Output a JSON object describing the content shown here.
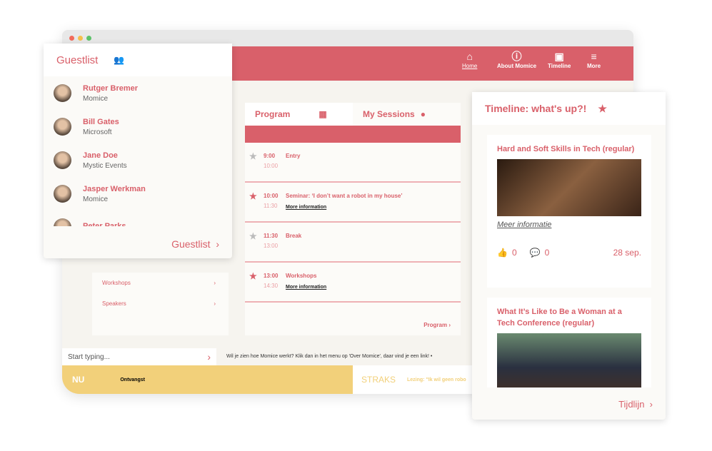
{
  "nav": [
    {
      "label": "Home",
      "icon": "home-icon"
    },
    {
      "label": "About Momice",
      "icon": "info-icon"
    },
    {
      "label": "Timeline",
      "icon": "tv-icon"
    },
    {
      "label": "More",
      "icon": "menu-icon"
    }
  ],
  "program": {
    "tabs": [
      "Program",
      "My Sessions"
    ],
    "link": "Program",
    "sessions": [
      {
        "start": "9:00",
        "end": "10:00",
        "title": "Entry",
        "starred": false,
        "more": ""
      },
      {
        "start": "10:00",
        "end": "11:30",
        "title": "Seminar: ‘I don’t want a robot in my house’",
        "starred": true,
        "more": "More information"
      },
      {
        "start": "11:30",
        "end": "13:00",
        "title": "Break",
        "starred": false,
        "more": ""
      },
      {
        "start": "13:00",
        "end": "14:30",
        "title": "Workshops",
        "starred": true,
        "more": "More information"
      }
    ]
  },
  "side": [
    "Workshops",
    "Speakers"
  ],
  "search": {
    "placeholder": "Start typing..."
  },
  "ticker": "Wil je zien hoe Momice werkt? Klik dan in het menu op 'Over Momice', daar vind je een link!   •",
  "now": {
    "label": "NU",
    "text": "Ontvangst"
  },
  "later": {
    "label": "STRAKS",
    "text": "Lezing: \"Ik wil geen robo"
  },
  "guestlist": {
    "title": "Guestlist",
    "footer": "Guestlist",
    "people": [
      {
        "name": "Rutger Bremer",
        "company": "Momice"
      },
      {
        "name": "Bill Gates",
        "company": "Microsoft"
      },
      {
        "name": "Jane Doe",
        "company": "Mystic Events"
      },
      {
        "name": "Jasper Werkman",
        "company": "Momice"
      },
      {
        "name": "Peter Parks",
        "company": ""
      }
    ]
  },
  "timeline": {
    "title": "Timeline: what's up?!",
    "footer": "Tijdlijn",
    "posts": [
      {
        "title": "Hard and Soft Skills in Tech (regular)",
        "more": "Meer informatie",
        "likes": "0",
        "comments": "0",
        "date": "28 sep."
      },
      {
        "title": "What It’s Like to Be a Woman at a Tech Conference (regular)"
      }
    ]
  },
  "colors": {
    "accent": "#d9606a",
    "yellow": "#f2d07a"
  }
}
